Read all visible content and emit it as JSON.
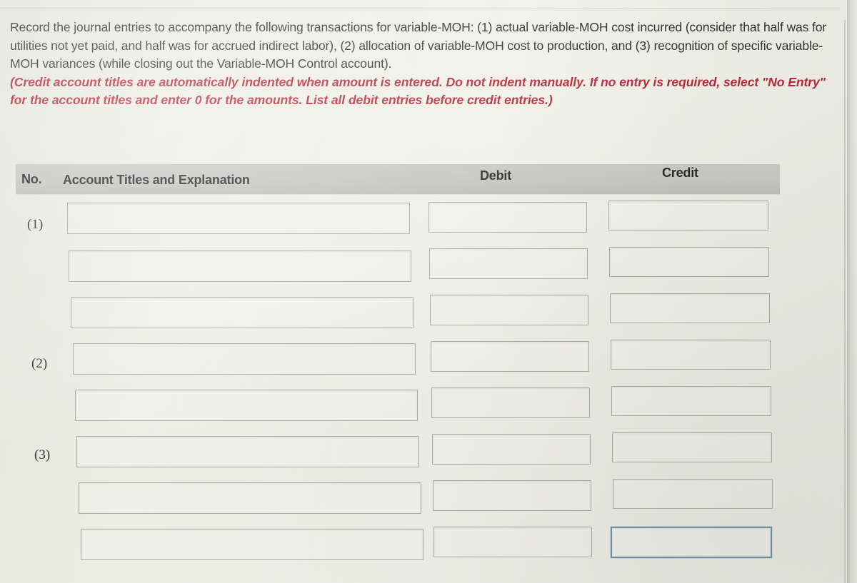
{
  "document": {
    "prompt_paragraph": "Record the journal entries to accompany the following transactions for variable-MOH: (1) actual variable-MOH cost incurred (consider that half was for utilities not yet paid, and half was for accrued indirect labor), (2) allocation of variable-MOH cost to production, and (3) recognition of specific variable-MOH variances (while closing out the Variable-MOH Control account).",
    "prompt_note": "(Credit account titles are automatically indented when amount is entered. Do not indent manually. If no entry is required, select \"No Entry\" for the account titles and enter 0 for the amounts. List all debit entries before credit entries.)"
  },
  "table": {
    "headers": {
      "no": "No.",
      "account_titles": "Account Titles and Explanation",
      "debit": "Debit",
      "credit": "Credit"
    },
    "row_labels": {
      "r1": "(1)",
      "r4": "(2)",
      "r6": "(3)"
    },
    "rows": [
      {
        "no": "(1)",
        "account_title": "",
        "debit": "",
        "credit": "",
        "credit_focused": false
      },
      {
        "no": "",
        "account_title": "",
        "debit": "",
        "credit": "",
        "credit_focused": false
      },
      {
        "no": "",
        "account_title": "",
        "debit": "",
        "credit": "",
        "credit_focused": false
      },
      {
        "no": "(2)",
        "account_title": "",
        "debit": "",
        "credit": "",
        "credit_focused": false
      },
      {
        "no": "",
        "account_title": "",
        "debit": "",
        "credit": "",
        "credit_focused": false
      },
      {
        "no": "(3)",
        "account_title": "",
        "debit": "",
        "credit": "",
        "credit_focused": false
      },
      {
        "no": "",
        "account_title": "",
        "debit": "",
        "credit": "",
        "credit_focused": false
      },
      {
        "no": "",
        "account_title": "",
        "debit": "",
        "credit": "",
        "credit_focused": true
      }
    ],
    "field_placeholder": ""
  },
  "colors": {
    "page_background": "#eceee4",
    "header_band": "#c4c5be",
    "note_red": "#b5293a",
    "body_text": "#2f3330",
    "field_border": "#a9aba3",
    "focused_field_border": "#6f8ca8"
  }
}
